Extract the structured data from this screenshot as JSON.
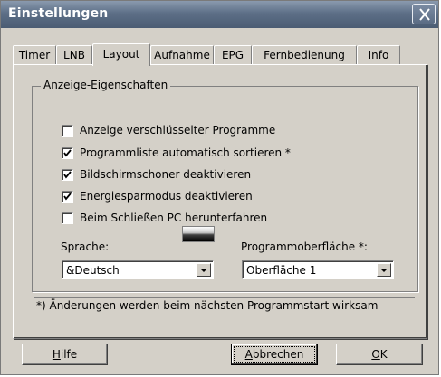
{
  "window": {
    "title": "Einstellungen",
    "close_label": "×"
  },
  "tabs": [
    {
      "label": "Timer",
      "active": false
    },
    {
      "label": "LNB",
      "active": false
    },
    {
      "label": "Layout",
      "active": true
    },
    {
      "label": "Aufnahme",
      "active": false
    },
    {
      "label": "EPG",
      "active": false
    },
    {
      "label": "Fernbedienung",
      "active": false
    },
    {
      "label": "Info",
      "active": false
    }
  ],
  "group": {
    "label": "Anzeige-Eigenschaften",
    "checkboxes": [
      {
        "label": "Anzeige verschlüsselter Programme",
        "checked": false
      },
      {
        "label": "Programmliste automatisch sortieren *",
        "checked": true
      },
      {
        "label": "Bildschirmschoner deaktivieren",
        "checked": true
      },
      {
        "label": "Energiesparmodus deaktivieren",
        "checked": true
      },
      {
        "label": "Beim Schließen PC herunterfahren",
        "checked": false
      }
    ],
    "language": {
      "label": "Sprache:",
      "value": "&Deutsch"
    },
    "ui": {
      "label": "Programmoberfläche *:",
      "value": "Oberfläche 1"
    },
    "note": "*) Änderungen werden beim nächsten Programmstart wirksam"
  },
  "buttons": {
    "help": {
      "prefix": "",
      "mnemonic": "H",
      "rest": "ilfe"
    },
    "cancel": {
      "prefix": "",
      "mnemonic": "A",
      "rest": "bbrechen"
    },
    "ok": {
      "prefix": "",
      "mnemonic": "O",
      "rest": "K"
    }
  },
  "colors": {
    "titlebar": "#5d6f87",
    "face": "#d4d0c8"
  }
}
